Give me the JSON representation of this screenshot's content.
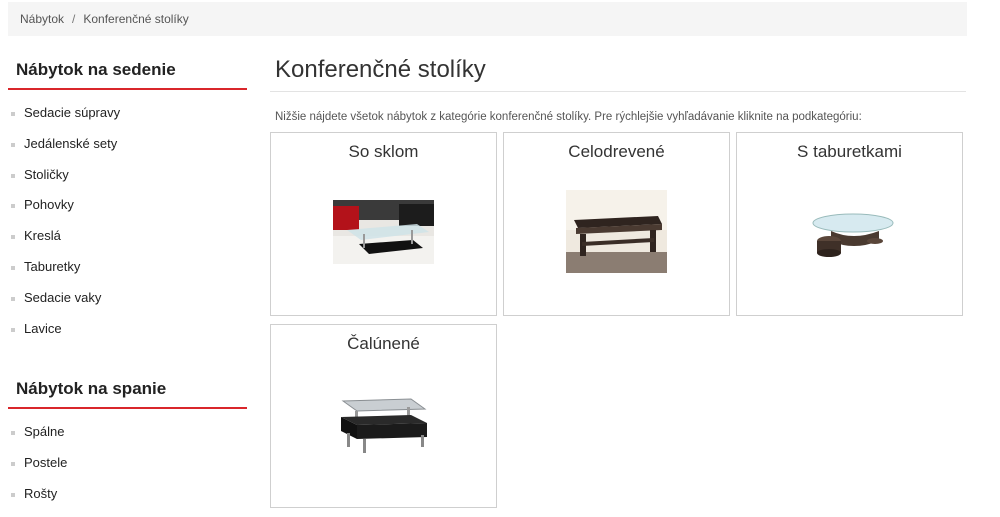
{
  "breadcrumb": {
    "items": [
      "Nábytok",
      "Konferenčné stolíky"
    ],
    "separator": "/"
  },
  "sidebar": {
    "sections": [
      {
        "title": "Nábytok na sedenie",
        "items": [
          "Sedacie súpravy",
          "Jedálenské sety",
          "Stoličky",
          "Pohovky",
          "Kreslá",
          "Taburetky",
          "Sedacie vaky",
          "Lavice"
        ]
      },
      {
        "title": "Nábytok na spanie",
        "items": [
          "Spálne",
          "Postele",
          "Rošty"
        ]
      }
    ]
  },
  "main": {
    "title": "Konferenčné stolíky",
    "intro": "Nižšie nájdete všetok nábytok z kategórie konferenčné stolíky. Pre rýchlejšie vyhľadávanie kliknite na podkategóriu:",
    "categories": [
      {
        "label": "So sklom"
      },
      {
        "label": "Celodrevené"
      },
      {
        "label": "S taburetkami"
      },
      {
        "label": "Čalúnené"
      }
    ]
  },
  "colors": {
    "accent": "#d9262b",
    "breadcrumb_bg": "#f5f5f5",
    "border": "#cfcfcf"
  }
}
